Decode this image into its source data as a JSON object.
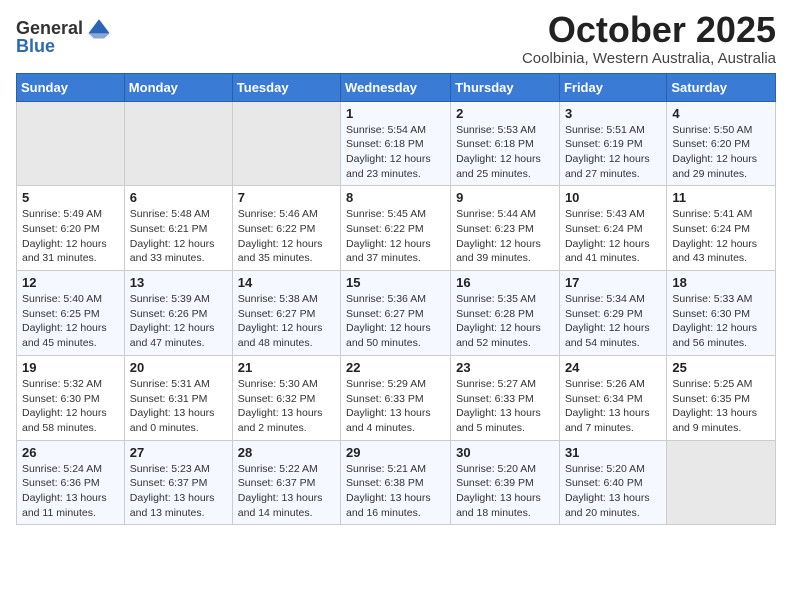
{
  "logo": {
    "general": "General",
    "blue": "Blue"
  },
  "header": {
    "month_title": "October 2025",
    "subtitle": "Coolbinia, Western Australia, Australia"
  },
  "weekdays": [
    "Sunday",
    "Monday",
    "Tuesday",
    "Wednesday",
    "Thursday",
    "Friday",
    "Saturday"
  ],
  "weeks": [
    [
      {
        "day": "",
        "info": ""
      },
      {
        "day": "",
        "info": ""
      },
      {
        "day": "",
        "info": ""
      },
      {
        "day": "1",
        "info": "Sunrise: 5:54 AM\nSunset: 6:18 PM\nDaylight: 12 hours\nand 23 minutes."
      },
      {
        "day": "2",
        "info": "Sunrise: 5:53 AM\nSunset: 6:18 PM\nDaylight: 12 hours\nand 25 minutes."
      },
      {
        "day": "3",
        "info": "Sunrise: 5:51 AM\nSunset: 6:19 PM\nDaylight: 12 hours\nand 27 minutes."
      },
      {
        "day": "4",
        "info": "Sunrise: 5:50 AM\nSunset: 6:20 PM\nDaylight: 12 hours\nand 29 minutes."
      }
    ],
    [
      {
        "day": "5",
        "info": "Sunrise: 5:49 AM\nSunset: 6:20 PM\nDaylight: 12 hours\nand 31 minutes."
      },
      {
        "day": "6",
        "info": "Sunrise: 5:48 AM\nSunset: 6:21 PM\nDaylight: 12 hours\nand 33 minutes."
      },
      {
        "day": "7",
        "info": "Sunrise: 5:46 AM\nSunset: 6:22 PM\nDaylight: 12 hours\nand 35 minutes."
      },
      {
        "day": "8",
        "info": "Sunrise: 5:45 AM\nSunset: 6:22 PM\nDaylight: 12 hours\nand 37 minutes."
      },
      {
        "day": "9",
        "info": "Sunrise: 5:44 AM\nSunset: 6:23 PM\nDaylight: 12 hours\nand 39 minutes."
      },
      {
        "day": "10",
        "info": "Sunrise: 5:43 AM\nSunset: 6:24 PM\nDaylight: 12 hours\nand 41 minutes."
      },
      {
        "day": "11",
        "info": "Sunrise: 5:41 AM\nSunset: 6:24 PM\nDaylight: 12 hours\nand 43 minutes."
      }
    ],
    [
      {
        "day": "12",
        "info": "Sunrise: 5:40 AM\nSunset: 6:25 PM\nDaylight: 12 hours\nand 45 minutes."
      },
      {
        "day": "13",
        "info": "Sunrise: 5:39 AM\nSunset: 6:26 PM\nDaylight: 12 hours\nand 47 minutes."
      },
      {
        "day": "14",
        "info": "Sunrise: 5:38 AM\nSunset: 6:27 PM\nDaylight: 12 hours\nand 48 minutes."
      },
      {
        "day": "15",
        "info": "Sunrise: 5:36 AM\nSunset: 6:27 PM\nDaylight: 12 hours\nand 50 minutes."
      },
      {
        "day": "16",
        "info": "Sunrise: 5:35 AM\nSunset: 6:28 PM\nDaylight: 12 hours\nand 52 minutes."
      },
      {
        "day": "17",
        "info": "Sunrise: 5:34 AM\nSunset: 6:29 PM\nDaylight: 12 hours\nand 54 minutes."
      },
      {
        "day": "18",
        "info": "Sunrise: 5:33 AM\nSunset: 6:30 PM\nDaylight: 12 hours\nand 56 minutes."
      }
    ],
    [
      {
        "day": "19",
        "info": "Sunrise: 5:32 AM\nSunset: 6:30 PM\nDaylight: 12 hours\nand 58 minutes."
      },
      {
        "day": "20",
        "info": "Sunrise: 5:31 AM\nSunset: 6:31 PM\nDaylight: 13 hours\nand 0 minutes."
      },
      {
        "day": "21",
        "info": "Sunrise: 5:30 AM\nSunset: 6:32 PM\nDaylight: 13 hours\nand 2 minutes."
      },
      {
        "day": "22",
        "info": "Sunrise: 5:29 AM\nSunset: 6:33 PM\nDaylight: 13 hours\nand 4 minutes."
      },
      {
        "day": "23",
        "info": "Sunrise: 5:27 AM\nSunset: 6:33 PM\nDaylight: 13 hours\nand 5 minutes."
      },
      {
        "day": "24",
        "info": "Sunrise: 5:26 AM\nSunset: 6:34 PM\nDaylight: 13 hours\nand 7 minutes."
      },
      {
        "day": "25",
        "info": "Sunrise: 5:25 AM\nSunset: 6:35 PM\nDaylight: 13 hours\nand 9 minutes."
      }
    ],
    [
      {
        "day": "26",
        "info": "Sunrise: 5:24 AM\nSunset: 6:36 PM\nDaylight: 13 hours\nand 11 minutes."
      },
      {
        "day": "27",
        "info": "Sunrise: 5:23 AM\nSunset: 6:37 PM\nDaylight: 13 hours\nand 13 minutes."
      },
      {
        "day": "28",
        "info": "Sunrise: 5:22 AM\nSunset: 6:37 PM\nDaylight: 13 hours\nand 14 minutes."
      },
      {
        "day": "29",
        "info": "Sunrise: 5:21 AM\nSunset: 6:38 PM\nDaylight: 13 hours\nand 16 minutes."
      },
      {
        "day": "30",
        "info": "Sunrise: 5:20 AM\nSunset: 6:39 PM\nDaylight: 13 hours\nand 18 minutes."
      },
      {
        "day": "31",
        "info": "Sunrise: 5:20 AM\nSunset: 6:40 PM\nDaylight: 13 hours\nand 20 minutes."
      },
      {
        "day": "",
        "info": ""
      }
    ]
  ]
}
